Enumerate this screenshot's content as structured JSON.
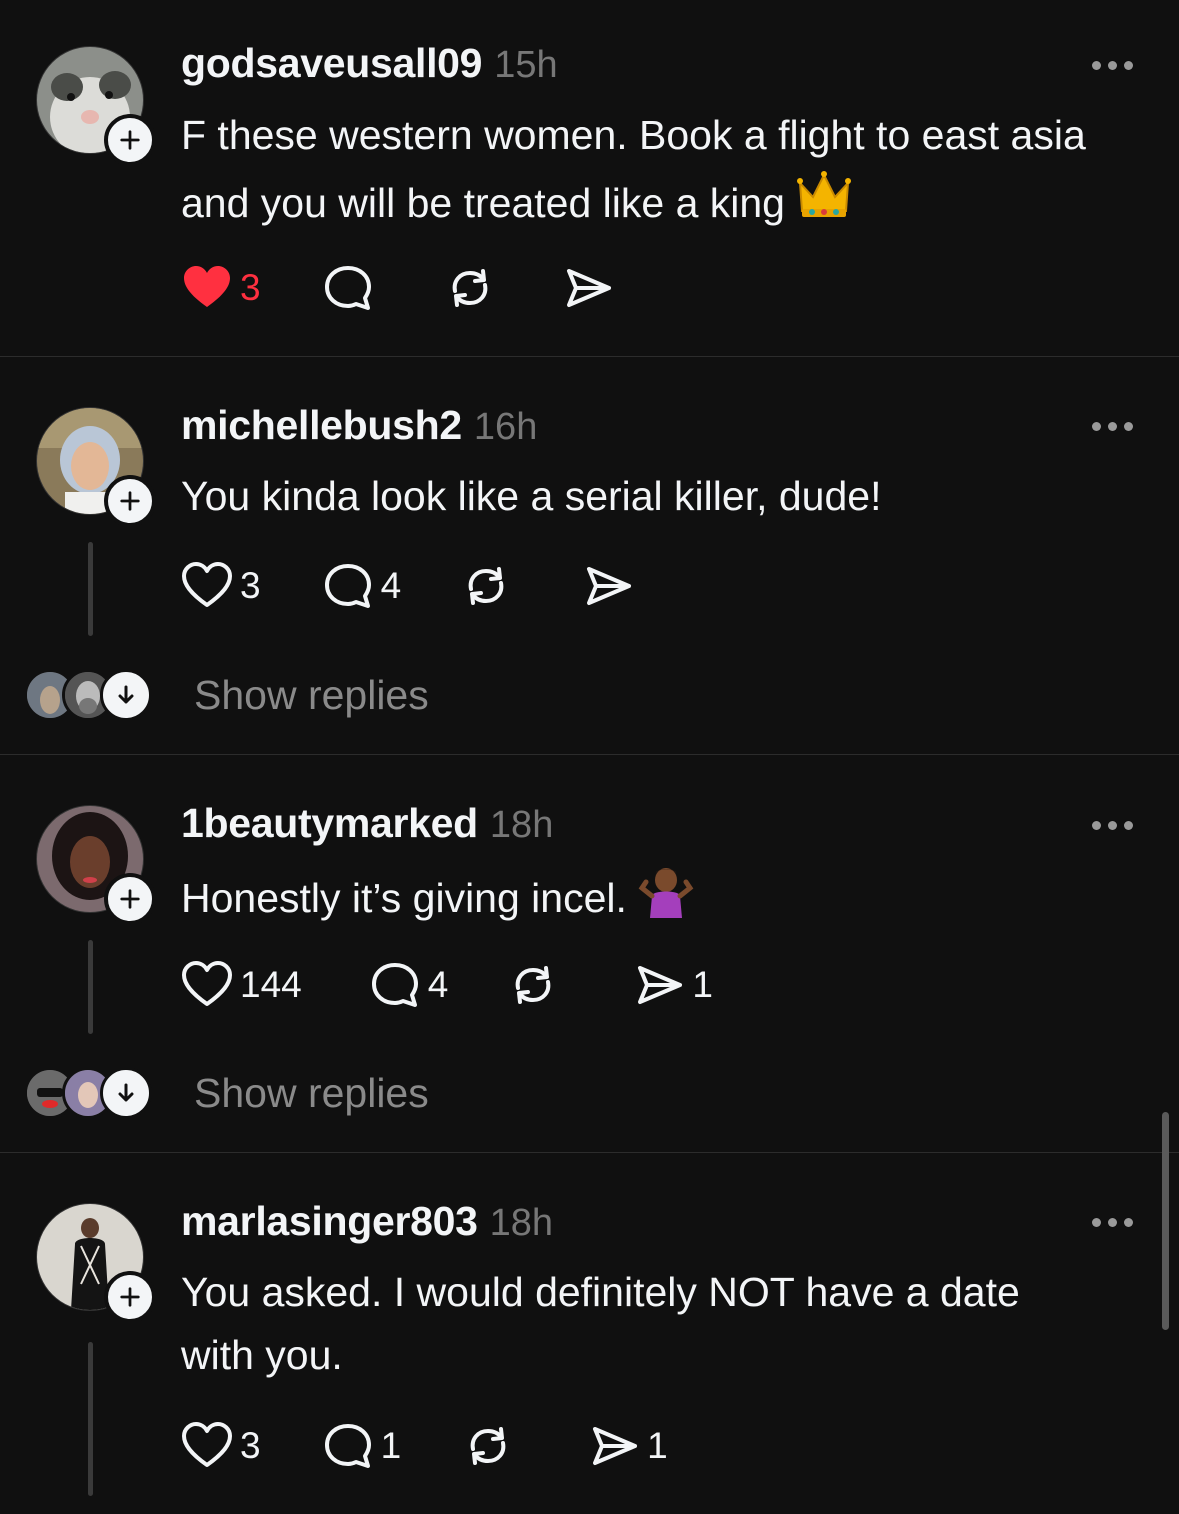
{
  "posts": [
    {
      "username": "godsaveusall09",
      "time": "15h",
      "text": "F these western women. Book a flight to east asia and you will be treated like a king",
      "emoji": "crown-emoji",
      "likes": "3",
      "liked": true,
      "comments": "",
      "reposts": "",
      "shares": ""
    },
    {
      "username": "michellebush2",
      "time": "16h",
      "text": "You kinda look like a serial killer, dude!",
      "likes": "3",
      "liked": false,
      "comments": "4",
      "reposts": "",
      "shares": "",
      "show_replies": "Show replies"
    },
    {
      "username": "1beautymarked",
      "time": "18h",
      "text": "Honestly it’s giving incel.",
      "emoji": "shrug-emoji",
      "likes": "144",
      "liked": false,
      "comments": "4",
      "reposts": "",
      "shares": "1",
      "show_replies": "Show replies"
    },
    {
      "username": "marlasinger803",
      "time": "18h",
      "text": "You asked. I would definitely NOT have a date with you.",
      "likes": "3",
      "liked": false,
      "comments": "1",
      "reposts": "",
      "shares": "1"
    }
  ],
  "colors": {
    "background": "#101010",
    "text": "#f3f5f7",
    "muted": "#777777",
    "like_red": "#ff3040",
    "divider": "#2c2c2c"
  }
}
